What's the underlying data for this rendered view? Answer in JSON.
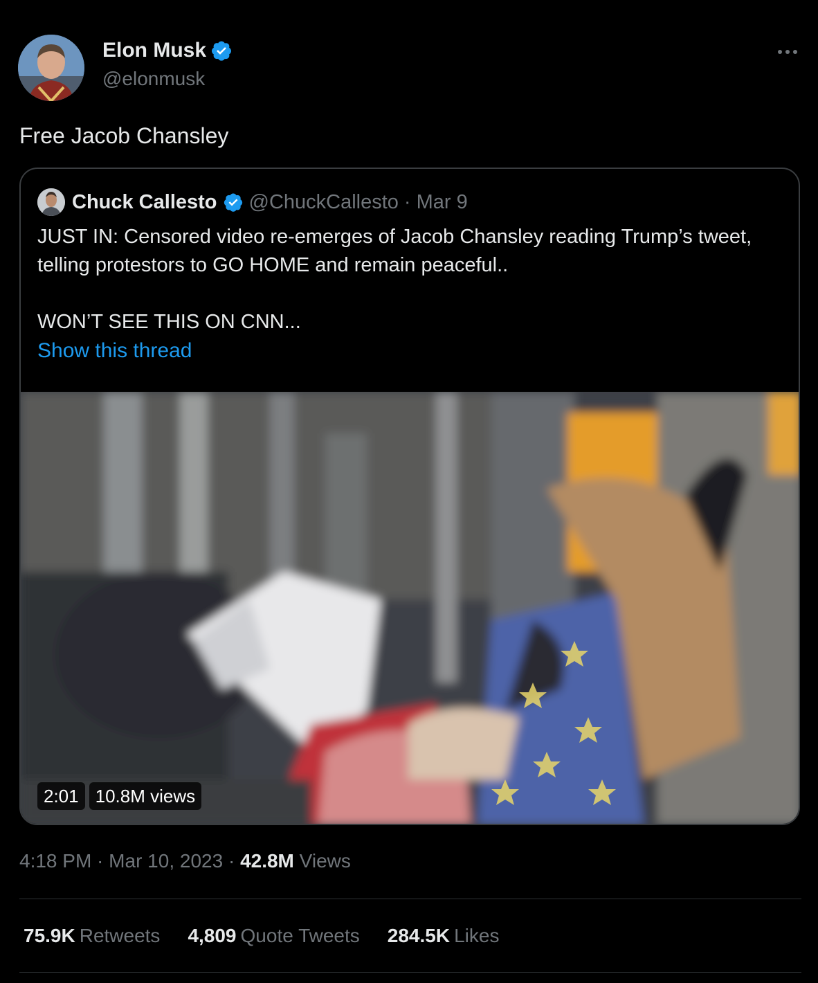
{
  "tweet": {
    "author_name": "Elon Musk",
    "author_handle": "@elonmusk",
    "text": "Free Jacob Chansley",
    "more_icon": "ellipsis-icon",
    "verified_icon": "verified-badge-icon"
  },
  "quote": {
    "author_name": "Chuck Callesto",
    "author_handle": "@ChuckCallesto",
    "separator": "·",
    "date": "Mar 9",
    "line1": "JUST IN: Censored video re-emerges of Jacob Chansley reading Trump’s tweet,",
    "line2": "telling protestors to GO HOME and remain peaceful..",
    "line3": "WON’T SEE THIS ON CNN...",
    "show_thread": "Show this thread",
    "video": {
      "duration": "2:01",
      "views": "10.8M views"
    }
  },
  "meta": {
    "time": "4:18 PM",
    "dot1": " · ",
    "date": "Mar 10, 2023",
    "dot2": " · ",
    "views_count": "42.8M",
    "views_label": "Views"
  },
  "stats": [
    {
      "count": "75.9K",
      "label": "Retweets"
    },
    {
      "count": "4,809",
      "label": "Quote Tweets"
    },
    {
      "count": "284.5K",
      "label": "Likes"
    }
  ],
  "colors": {
    "background": "#000000",
    "text": "#e7e9ea",
    "secondary": "#71767b",
    "link": "#1d9bf0",
    "border": "#2f3336"
  }
}
